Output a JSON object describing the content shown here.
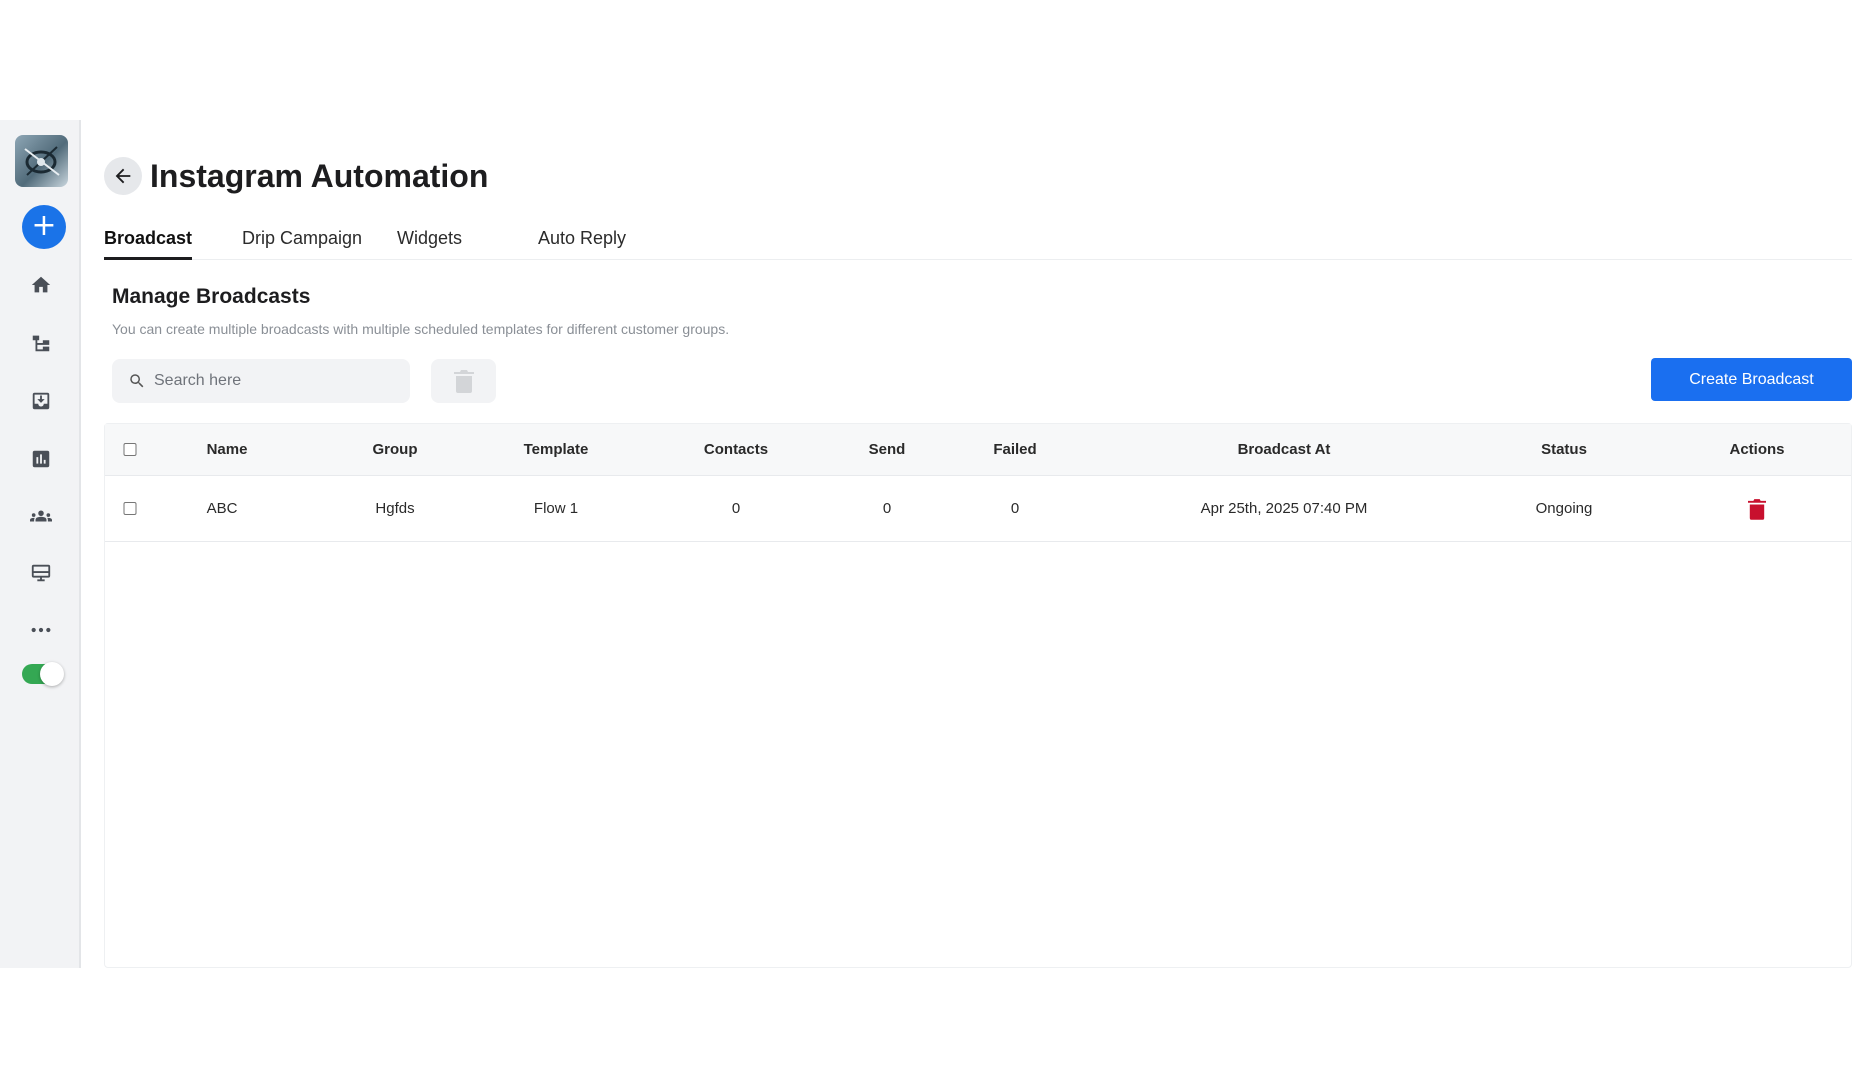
{
  "app": {
    "title": "Instagram Automation"
  },
  "sidebar": {
    "items": [
      {
        "name": "home-icon"
      },
      {
        "name": "flow-icon"
      },
      {
        "name": "inbox-icon"
      },
      {
        "name": "analytics-icon"
      },
      {
        "name": "contacts-icon"
      },
      {
        "name": "widget-icon"
      },
      {
        "name": "more-icon"
      }
    ],
    "toggle_on": true,
    "accent": "#1a73e8",
    "toggle_color": "#34a853"
  },
  "tabs": [
    {
      "label": "Broadcast",
      "active": true
    },
    {
      "label": "Drip Campaign",
      "active": false
    },
    {
      "label": "Widgets",
      "active": false
    },
    {
      "label": "Auto Reply",
      "active": false
    }
  ],
  "section": {
    "title": "Manage Broadcasts",
    "subtitle": "You can create multiple broadcasts with multiple scheduled templates for different customer groups."
  },
  "search": {
    "placeholder": "Search here",
    "value": ""
  },
  "create_button": {
    "label": "Create Broadcast",
    "color": "#1a6ff0"
  },
  "table": {
    "columns": [
      "Name",
      "Group",
      "Template",
      "Contacts",
      "Send",
      "Failed",
      "Broadcast At",
      "Status",
      "Actions"
    ],
    "rows": [
      {
        "name": "ABC",
        "group": "Hgfds",
        "template": "Flow 1",
        "contacts": "0",
        "send": "0",
        "failed": "0",
        "broadcast_at": "Apr 25th, 2025 07:40 PM",
        "status": "Ongoing",
        "delete_color": "#c8102e"
      }
    ]
  }
}
